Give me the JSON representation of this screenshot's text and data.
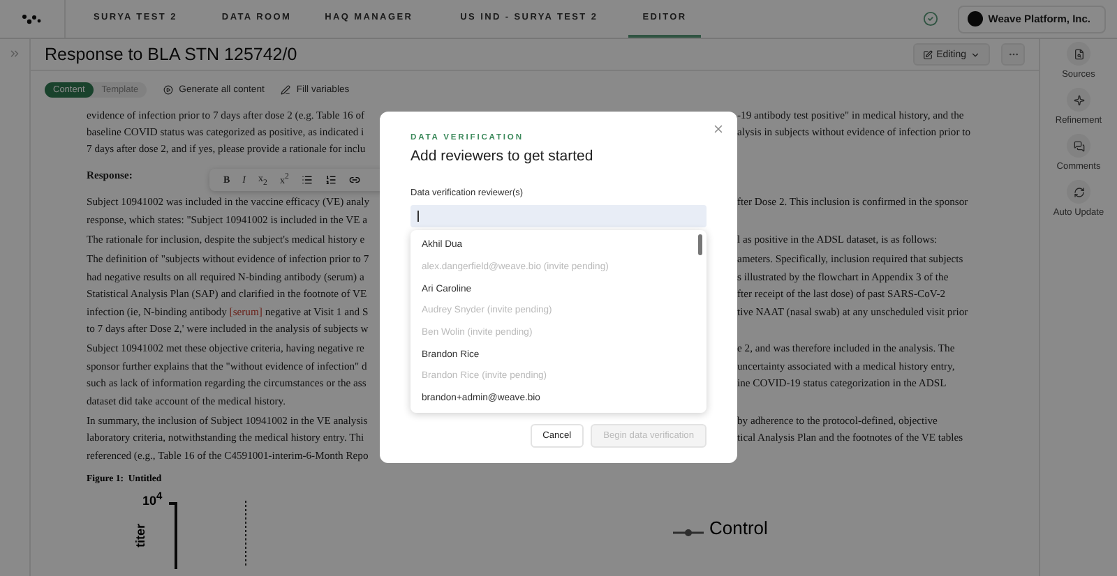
{
  "header": {
    "nav": [
      {
        "label": "SURYA TEST 2",
        "selected": false
      },
      {
        "label": "DATA ROOM",
        "selected": false
      },
      {
        "label": "HAQ MANAGER",
        "selected": false
      },
      {
        "label": "US IND - SURYA TEST 2",
        "selected": false
      },
      {
        "label": "EDITOR",
        "selected": true
      }
    ],
    "org": "Weave Platform, Inc."
  },
  "document": {
    "title": "Response to BLA STN 125742/0",
    "mode": "Editing",
    "view_tabs": [
      {
        "label": "Content",
        "selected": true
      },
      {
        "label": "Template",
        "selected": false
      }
    ],
    "actions": [
      "Generate all content",
      "Fill variables"
    ],
    "lines": [
      {
        "left": "evidence of infection prior to 7 days after dose 2 (e.g. Table 16 of",
        "right": "-19 antibody test positive\" in medical history, and the"
      },
      {
        "left": "baseline COVID status was categorized as positive, as indicated i",
        "right": "alysis in subjects without evidence of infection prior to"
      },
      {
        "left": "7 days after dose 2, and if yes, please provide a rationale for inclu"
      },
      {
        "kind": "heading",
        "left": "Response:"
      },
      {
        "left": "Subject 10941002 was included in the vaccine efficacy (VE) analy",
        "right": "fter Dose 2. This inclusion is confirmed in the sponsor"
      },
      {
        "left": "response, which states: \"Subject 10941002 is included in the VE a"
      },
      {
        "kind": "para",
        "left": "The rationale for inclusion, despite the subject's medical history e",
        "right": "l as positive in the ADSL dataset, is as follows:"
      },
      {
        "kind": "para",
        "left": "The definition of \"subjects without evidence of infection prior to 7",
        "right": "ameters. Specifically, inclusion required that subjects"
      },
      {
        "left": "had negative results on all required N-binding antibody (serum) a",
        "right": "s illustrated by the flowchart in Appendix 3 of the"
      },
      {
        "left": "Statistical Analysis Plan (SAP) and clarified in the footnote of VE",
        "right": "fter receipt of the last dose) of past SARS-CoV-2"
      },
      {
        "left": "infection (ie, N-binding antibody ",
        "flag": "[serum]",
        "after": " negative at Visit 1 and S",
        "right": "tive NAAT (nasal swab) at any unscheduled visit prior"
      },
      {
        "left": "to 7 days after Dose 2,' were included in the analysis of subjects w"
      },
      {
        "kind": "para",
        "left": "Subject 10941002 met these objective criteria, having negative re",
        "right": "e 2, and was therefore included in the analysis. The"
      },
      {
        "left": "sponsor further explains that the \"without evidence of infection\" d",
        "right": "uncertainty associated with a medical history entry,"
      },
      {
        "left": "such as lack of information regarding the circumstances or the ass",
        "right": "ine COVID-19 status categorization in the ADSL"
      },
      {
        "left": "dataset did take account of the medical history."
      },
      {
        "kind": "para",
        "left": "In summary, the inclusion of Subject 10941002 in the VE analysis",
        "right": "by adherence to the protocol-defined, objective"
      },
      {
        "left": "laboratory criteria, notwithstanding the medical history entry. Thi",
        "right": "tical Analysis Plan and the footnotes of the VE tables"
      },
      {
        "left": "referenced (e.g., Table 16 of the C4591001-interim-6-Month Repo"
      }
    ],
    "format_toolbar": [
      "B",
      "I",
      "x$_{2}$",
      "x$^{2}$"
    ],
    "figure": {
      "caption": "Figure 1:  Untitled",
      "y_tick": "10$^{4}$",
      "y_label": "titer",
      "legend": "Control"
    }
  },
  "side_panel": [
    "Sources",
    "Refinement",
    "Comments",
    "Auto Update"
  ],
  "dialog": {
    "eyebrow": "DATA VERIFICATION",
    "title": "Add reviewers to get started",
    "field_label": "Data verification reviewer(s)",
    "options": [
      {
        "label": "Akhil Dua",
        "disabled": false
      },
      {
        "label": "alex.dangerfield@weave.bio (invite pending)",
        "disabled": true
      },
      {
        "label": "Ari Caroline",
        "disabled": false
      },
      {
        "label": "Audrey Snyder (invite pending)",
        "disabled": true
      },
      {
        "label": "Ben Wolin (invite pending)",
        "disabled": true
      },
      {
        "label": "Brandon Rice",
        "disabled": false
      },
      {
        "label": "Brandon Rice (invite pending)",
        "disabled": true
      },
      {
        "label": "brandon+admin@weave.bio",
        "disabled": false
      }
    ],
    "cancel": "Cancel",
    "confirm": {
      "label": "Begin data verification",
      "disabled": true
    }
  }
}
